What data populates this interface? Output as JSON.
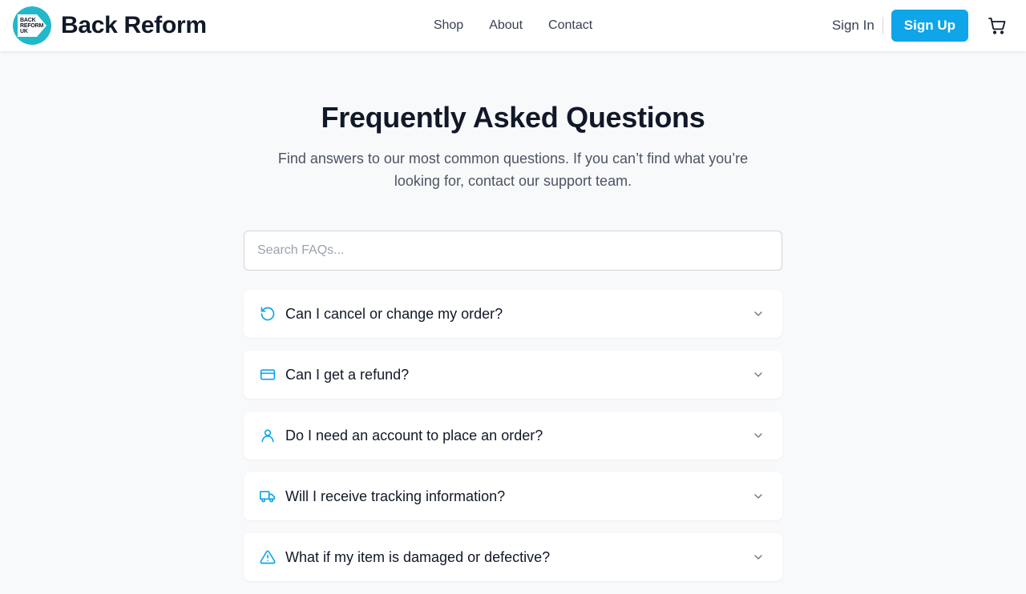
{
  "brand": {
    "name": "Back Reform",
    "logo_lines": [
      "BACK",
      "REFORM",
      "UK"
    ]
  },
  "nav": {
    "items": [
      "Shop",
      "About",
      "Contact"
    ]
  },
  "auth": {
    "sign_in": "Sign In",
    "sign_up": "Sign Up"
  },
  "colors": {
    "accent": "#0ea5e9",
    "logo": "#22b8c9",
    "icon": "#0ea5e9"
  },
  "hero": {
    "title": "Frequently Asked Questions",
    "subtitle": "Find answers to our most common questions. If you can’t find what you’re looking for, contact our support team."
  },
  "search": {
    "placeholder": "Search FAQs...",
    "value": ""
  },
  "faqs": [
    {
      "icon": "refresh-icon",
      "question": "Can I cancel or change my order?"
    },
    {
      "icon": "credit-card-icon",
      "question": "Can I get a refund?"
    },
    {
      "icon": "user-icon",
      "question": "Do I need an account to place an order?"
    },
    {
      "icon": "truck-icon",
      "question": "Will I receive tracking information?"
    },
    {
      "icon": "alert-triangle-icon",
      "question": "What if my item is damaged or defective?"
    }
  ]
}
